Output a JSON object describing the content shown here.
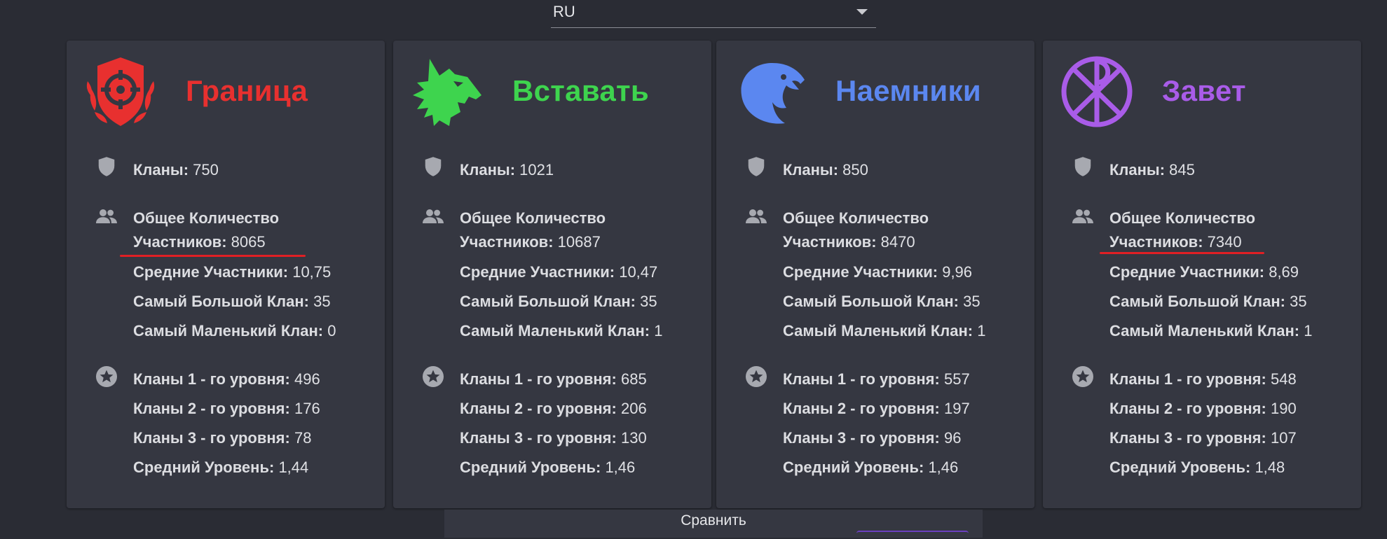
{
  "language": {
    "selected": "RU"
  },
  "compare_label": "Сравнить",
  "labels": {
    "clans": "Кланы:",
    "total_members_line1": "Общее Количество",
    "total_members_line2": "Участников:",
    "avg_members": "Средние Участники:",
    "largest_clan": "Самый Большой Клан:",
    "smallest_clan": "Самый Маленький Клан:",
    "lvl1": "Кланы 1 - го уровня:",
    "lvl2": "Кланы 2 - го уровня:",
    "lvl3": "Кланы 3 - го уровня:",
    "avg_level": "Средний Уровень:"
  },
  "factions": [
    {
      "name": "Граница",
      "color": "#e8302f",
      "icon": "crosshair-shield-icon",
      "clans": "750",
      "members": "8065",
      "avg_members": "10,75",
      "largest": "35",
      "smallest": "0",
      "lvl1": "496",
      "lvl2": "176",
      "lvl3": "78",
      "avg_level": "1,44",
      "underlined": true
    },
    {
      "name": "Вставать",
      "color": "#3ed44e",
      "icon": "wolf-head-icon",
      "clans": "1021",
      "members": "10687",
      "avg_members": "10,47",
      "largest": "35",
      "smallest": "1",
      "lvl1": "685",
      "lvl2": "206",
      "lvl3": "130",
      "avg_level": "1,46",
      "underlined": false
    },
    {
      "name": "Наемники",
      "color": "#5b87f0",
      "icon": "eagle-head-icon",
      "clans": "850",
      "members": "8470",
      "avg_members": "9,96",
      "largest": "35",
      "smallest": "1",
      "lvl1": "557",
      "lvl2": "197",
      "lvl3": "96",
      "avg_level": "1,46",
      "underlined": false
    },
    {
      "name": "Завет",
      "color": "#a95ce8",
      "icon": "chi-rho-icon",
      "clans": "845",
      "members": "7340",
      "avg_members": "8,69",
      "largest": "35",
      "smallest": "1",
      "lvl1": "548",
      "lvl2": "190",
      "lvl3": "107",
      "avg_level": "1,48",
      "underlined": true
    }
  ]
}
